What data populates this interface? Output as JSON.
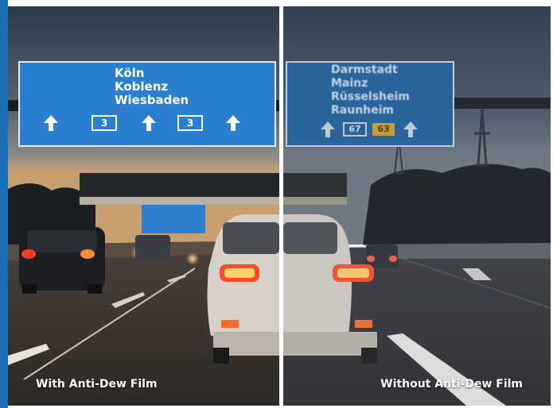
{
  "image": {
    "left_label": "With Anti-Dew Film",
    "right_label": "Without Anti-Dew Film",
    "left_sign": {
      "destinations": [
        "Köln",
        "Koblenz",
        "Wiesbaden"
      ],
      "route_numbers": [
        "3",
        "3"
      ]
    },
    "right_sign": {
      "destinations": [
        "Darmstadt",
        "Mainz",
        "Rüsselsheim",
        "Raunheim"
      ],
      "route_numbers": [
        "67",
        "63"
      ]
    },
    "colors": {
      "accent": "#1d6fb8",
      "sign_blue": "#2a7fd0",
      "sign_blue_dark": "#1d5f9c",
      "sky_top": "#2c3848",
      "road": "#3a3430"
    }
  }
}
